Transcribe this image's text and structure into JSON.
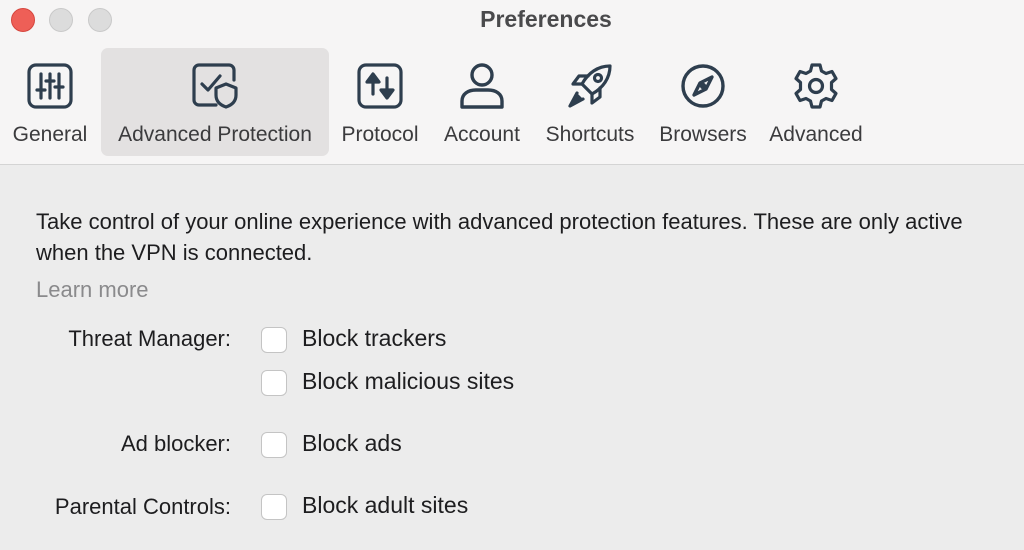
{
  "window": {
    "title": "Preferences"
  },
  "toolbar": {
    "tabs": [
      {
        "label": "General",
        "icon": "sliders-icon",
        "selected": false
      },
      {
        "label": "Advanced Protection",
        "icon": "shield-check-icon",
        "selected": true
      },
      {
        "label": "Protocol",
        "icon": "protocol-arrows-icon",
        "selected": false
      },
      {
        "label": "Account",
        "icon": "person-icon",
        "selected": false
      },
      {
        "label": "Shortcuts",
        "icon": "rocket-icon",
        "selected": false
      },
      {
        "label": "Browsers",
        "icon": "compass-icon",
        "selected": false
      },
      {
        "label": "Advanced",
        "icon": "gear-icon",
        "selected": false
      }
    ]
  },
  "content": {
    "description": "Take control of your online experience with advanced protection features. These are only active when the VPN is connected.",
    "learn_more": "Learn more",
    "threat_manager": {
      "label": "Threat Manager:",
      "options": [
        {
          "label": "Block trackers",
          "checked": false
        },
        {
          "label": "Block malicious sites",
          "checked": false
        }
      ]
    },
    "ad_blocker": {
      "label": "Ad blocker:",
      "options": [
        {
          "label": "Block ads",
          "checked": false
        }
      ]
    },
    "parental_controls": {
      "label": "Parental Controls:",
      "options": [
        {
          "label": "Block adult sites",
          "checked": false
        }
      ]
    }
  },
  "colors": {
    "close_button": "#ee5f57",
    "inactive_button": "#dcdcdc",
    "toolbar_background": "#f6f5f5",
    "selected_tab": "#e3e1e1",
    "content_background": "#ececec",
    "icon": "#2e3e4e",
    "link_gray": "#8a8a8c"
  }
}
